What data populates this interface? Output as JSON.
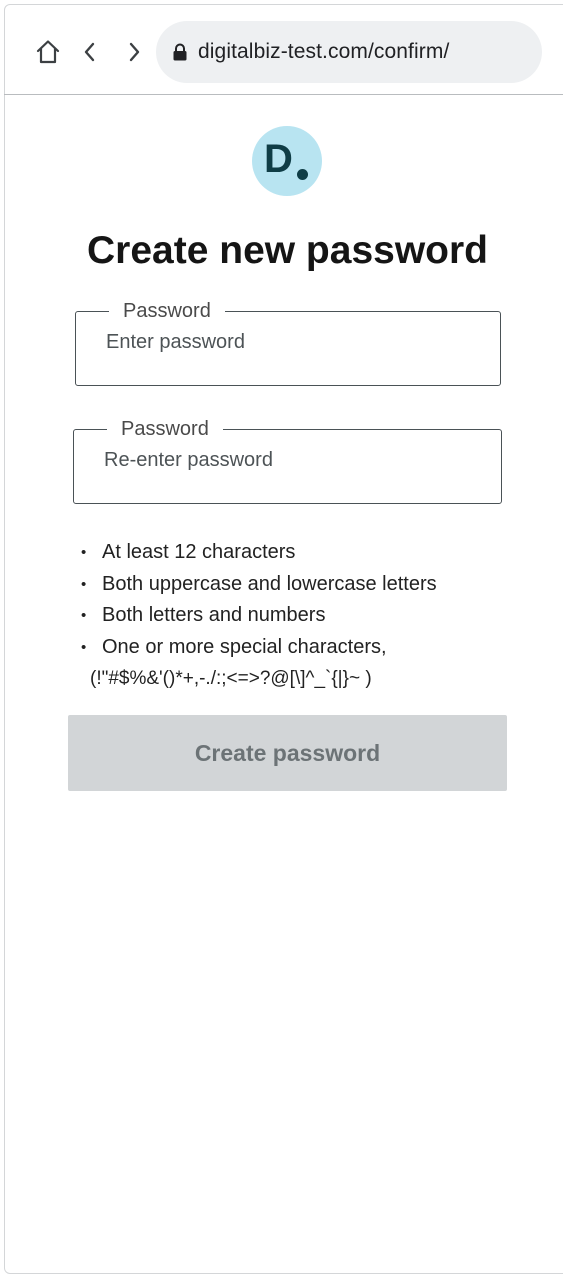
{
  "browser": {
    "url": "digitalbiz-test.com/confirm/",
    "icons": {
      "home": "home-icon",
      "back": "chevron-left-icon",
      "forward": "chevron-right-icon",
      "lock": "lock-icon"
    }
  },
  "brand": {
    "logo_letter": "D",
    "logo_bg_color": "#b8e4f1",
    "logo_fg_color": "#0f3d46"
  },
  "page": {
    "title": "Create new password"
  },
  "form": {
    "password_field": {
      "label": "Password",
      "placeholder": "Enter password",
      "value": ""
    },
    "confirm_field": {
      "label": "Password",
      "placeholder": "Re-enter password",
      "value": ""
    },
    "requirements": [
      "At least 12 characters",
      "Both uppercase and lowercase letters",
      "Both letters and numbers",
      "One or more special characters,"
    ],
    "special_characters": "(!\"#$%&'()*+,-./:;<=>?@[\\]^_`{|}~ )",
    "submit_label": "Create password",
    "submit_disabled": true
  }
}
